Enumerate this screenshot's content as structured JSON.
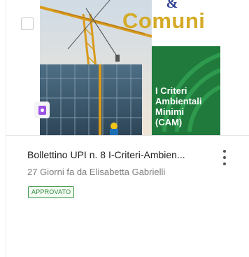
{
  "card": {
    "title": "Bollettino UPI n. 8 I-Criteri-Ambien...",
    "meta": "27 Giorni fa da Elisabetta Gabrielli",
    "status": "APPROVATO",
    "checkbox_checked": false,
    "type_icon": "document-icon",
    "menu_icon": "kebab-menu-icon"
  },
  "thumbnail": {
    "ampersand": "&",
    "heading": "Comuni",
    "cam_lines": [
      "I Criteri",
      "Ambientali",
      "Minimi",
      "(CAM)"
    ],
    "colors": {
      "heading": "#d4aa27",
      "panel_green": "#1f7a3c",
      "status_green": "#3f9b4a",
      "doc_badge": "#9b52e6"
    }
  }
}
